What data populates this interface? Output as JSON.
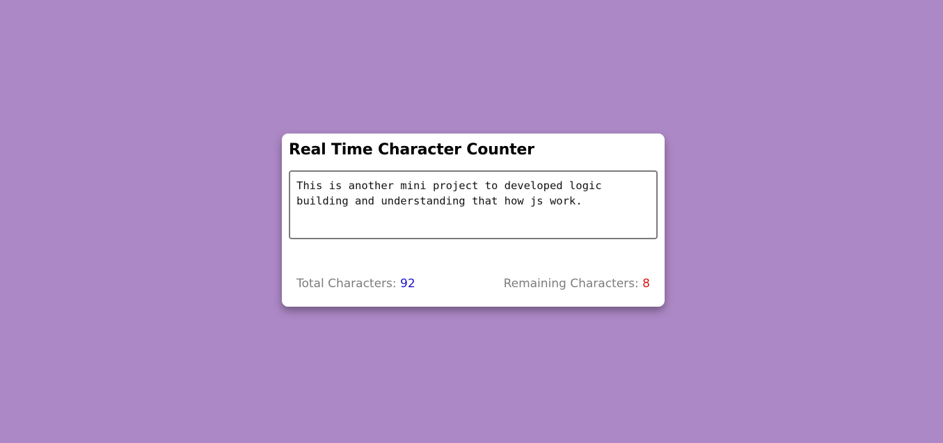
{
  "app": {
    "title": "Real Time Character Counter"
  },
  "editor": {
    "value": "This is another mini project to developed logic building and understanding that how js work.",
    "placeholder": ""
  },
  "stats": {
    "total_label": "Total Characters:",
    "total_value": "92",
    "remaining_label": "Remaining Characters:",
    "remaining_value": "8"
  },
  "colors": {
    "background": "#ad88c6",
    "card": "#ffffff",
    "total_value": "#1a14c8",
    "remaining_value": "#e01515",
    "label": "#7d7d7d"
  }
}
